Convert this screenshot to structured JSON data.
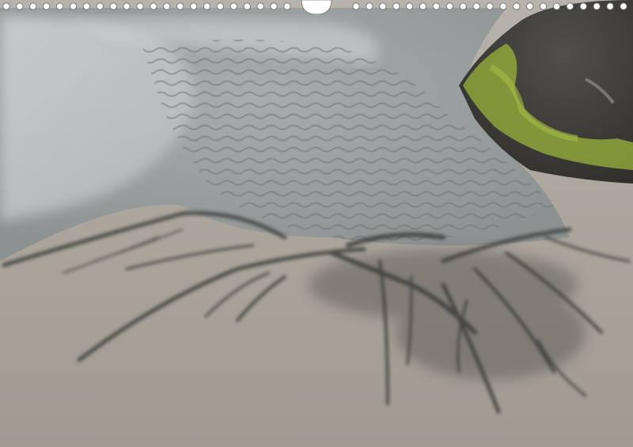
{
  "scene": {
    "subject": "sand-pattern-photo",
    "colors": {
      "sand_light": "#b9b3aa",
      "sand_mid": "#a39d94",
      "water": "#9aa2a3",
      "ripple": "#6f7474",
      "channel_dark": "#3e3f3c",
      "rock": "#3f3e3a",
      "moss": "#8fa53a",
      "binding_ring": "#ffffff"
    }
  },
  "calendar_binding": {
    "visible": true,
    "ring_count": 46
  }
}
